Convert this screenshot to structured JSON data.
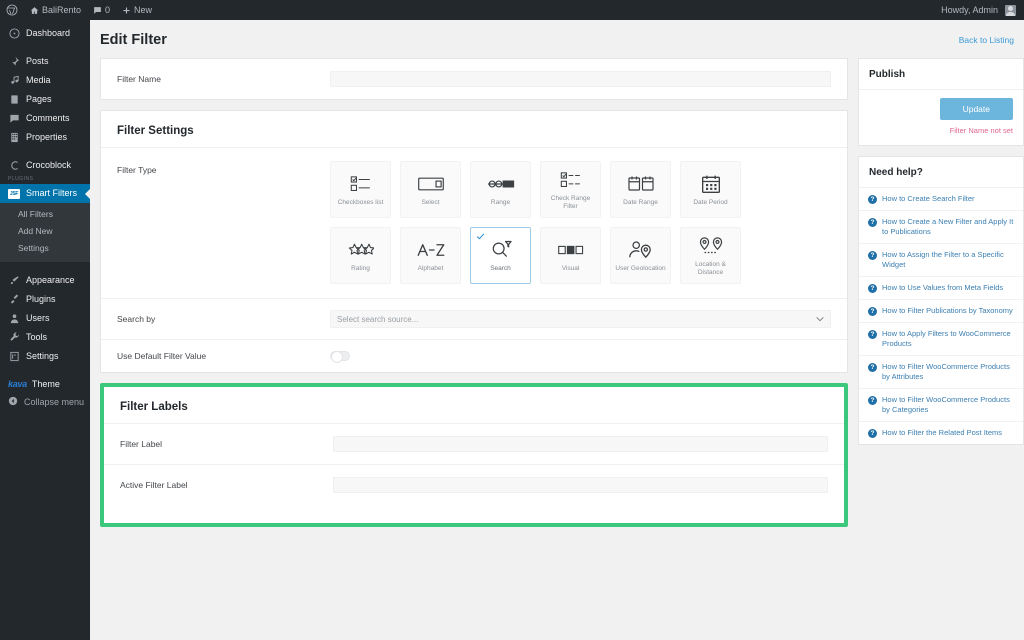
{
  "adminbar": {
    "wp_logo": "wordpress-icon",
    "site_name": "BaliRento",
    "comments_count": "0",
    "new_label": "New",
    "howdy": "Howdy, Admin"
  },
  "sidebar": {
    "items": [
      {
        "label": "Dashboard",
        "icon": "dashboard-icon"
      },
      {
        "label": "Posts",
        "icon": "pin-icon"
      },
      {
        "label": "Media",
        "icon": "media-icon"
      },
      {
        "label": "Pages",
        "icon": "page-icon"
      },
      {
        "label": "Comments",
        "icon": "comment-icon"
      },
      {
        "label": "Properties",
        "icon": "building-icon"
      },
      {
        "label": "Crocoblock",
        "icon": "crocoblock-icon"
      }
    ],
    "plugin_tag": "PLUGINS",
    "current": {
      "label": "Smart Filters",
      "icon": "smart-filters-icon"
    },
    "submenu": [
      {
        "label": "All Filters"
      },
      {
        "label": "Add New"
      },
      {
        "label": "Settings"
      }
    ],
    "items_bottom": [
      {
        "label": "Appearance",
        "icon": "brush-icon"
      },
      {
        "label": "Plugins",
        "icon": "plug-icon"
      },
      {
        "label": "Users",
        "icon": "user-icon"
      },
      {
        "label": "Tools",
        "icon": "wrench-icon"
      },
      {
        "label": "Settings",
        "icon": "settings-icon"
      }
    ],
    "theme": {
      "logo": "kava",
      "label": "Theme"
    },
    "collapse": {
      "label": "Collapse menu",
      "icon": "collapse-icon"
    }
  },
  "page": {
    "title": "Edit Filter",
    "back_link": "Back to Listing"
  },
  "filter_name": {
    "label": "Filter Name",
    "value": "",
    "placeholder": ""
  },
  "filter_settings": {
    "title": "Filter Settings",
    "type_label": "Filter Type",
    "types": [
      {
        "name": "Checkboxes list",
        "icon": "checkbox-list-icon",
        "selected": false
      },
      {
        "name": "Select",
        "icon": "select-box-icon",
        "selected": false
      },
      {
        "name": "Range",
        "icon": "range-slider-icon",
        "selected": false
      },
      {
        "name": "Check Range Filter",
        "icon": "check-range-icon",
        "selected": false
      },
      {
        "name": "Date Range",
        "icon": "date-range-icon",
        "selected": false
      },
      {
        "name": "Date Period",
        "icon": "date-period-icon",
        "selected": false
      },
      {
        "name": "Rating",
        "icon": "stars-icon",
        "selected": false
      },
      {
        "name": "Alphabet",
        "icon": "alphabet-icon",
        "selected": false
      },
      {
        "name": "Search",
        "icon": "search-magnifier-icon",
        "selected": true
      },
      {
        "name": "Visual",
        "icon": "visual-swatches-icon",
        "selected": false
      },
      {
        "name": "User Geolocation",
        "icon": "user-geolocation-icon",
        "selected": false
      },
      {
        "name": "Location & Distance",
        "icon": "location-distance-icon",
        "selected": false
      }
    ],
    "search_by": {
      "label": "Search by",
      "value": "Select search source...",
      "chevron": "chevron-down-icon"
    },
    "use_default": {
      "label": "Use Default Filter Value",
      "state": "off"
    }
  },
  "filter_labels": {
    "title": "Filter Labels",
    "filter_label": {
      "label": "Filter Label",
      "value": ""
    },
    "active_filter_label": {
      "label": "Active Filter Label",
      "value": ""
    },
    "highlight_color": "#3cc87c"
  },
  "publish": {
    "title": "Publish",
    "update_label": "Update",
    "note": "Filter Name not set",
    "button_color": "#6cb5dd"
  },
  "help": {
    "title": "Need help?",
    "links": [
      "How to Create Search Filter",
      "How to Create a New Filter and Apply It to Publications",
      "How to Assign the Filter to a Specific Widget",
      "How to Use Values from Meta Fields",
      "How to Filter Publications by Taxonomy",
      "How to Apply Filters to WooCommerce Products",
      "How to Filter WooCommerce Products by Attributes",
      "How to Filter WooCommerce Products by Categories",
      "How to Filter the Related Post Items"
    ]
  }
}
